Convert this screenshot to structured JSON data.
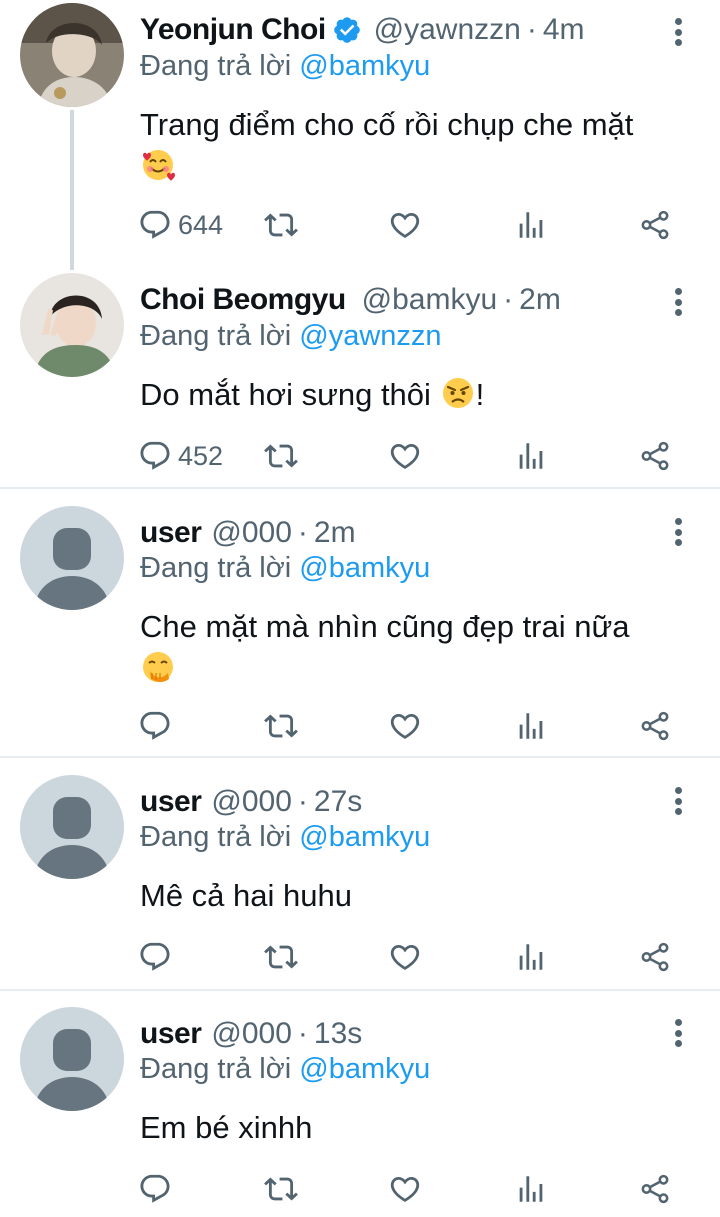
{
  "tweets": [
    {
      "name": "Yeonjun Choi",
      "verified": true,
      "handle": "@yawnzzn",
      "separator": "·",
      "time": "4m",
      "reply_prefix": "Đang trả lời",
      "reply_to": "@bamkyu",
      "text": "Trang điểm cho cố rồi chụp che mặt",
      "emoji": "smiling-face-with-hearts",
      "reply_count": "644"
    },
    {
      "name": "Choi Beomgyu",
      "verified": false,
      "handle": "@bamkyu",
      "separator": "·",
      "time": "2m",
      "reply_prefix": "Đang trả lời",
      "reply_to": "@yawnzzn",
      "text": "Do mắt hơi sưng thôi",
      "emoji": "angry-face",
      "text_suffix": "!",
      "reply_count": "452"
    },
    {
      "name": "user",
      "verified": false,
      "handle": "@000",
      "separator": "·",
      "time": "2m",
      "reply_prefix": "Đang trả lời",
      "reply_to": "@bamkyu",
      "text": "Che mặt mà nhìn cũng đẹp trai nữa",
      "emoji": "face-with-hand-over-mouth",
      "reply_count": ""
    },
    {
      "name": "user",
      "verified": false,
      "handle": "@000",
      "separator": "·",
      "time": "27s",
      "reply_prefix": "Đang trả lời",
      "reply_to": "@bamkyu",
      "text": "Mê cả hai huhu",
      "reply_count": ""
    },
    {
      "name": "user",
      "verified": false,
      "handle": "@000",
      "separator": "·",
      "time": "13s",
      "reply_prefix": "Đang trả lời",
      "reply_to": "@bamkyu",
      "text": "Em bé xinhh",
      "reply_count": ""
    }
  ],
  "colors": {
    "link": "#1d9bf0",
    "secondary_text": "#536471",
    "divider": "#e6ecf0",
    "thread_line": "#cfd9de",
    "default_avatar_bg": "#ccd6dd",
    "default_avatar_fg": "#66757f"
  },
  "icons": [
    "reply-icon",
    "retweet-icon",
    "like-icon",
    "analytics-icon",
    "share-icon",
    "more-icon",
    "verified-badge-icon"
  ]
}
